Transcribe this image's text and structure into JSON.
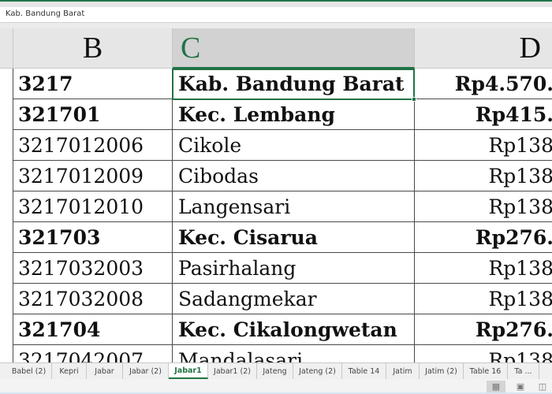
{
  "formula_bar": {
    "value": "Kab. Bandung Barat"
  },
  "column_headers": [
    {
      "label": "B",
      "selected": false
    },
    {
      "label": "C",
      "selected": true
    },
    {
      "label": "D",
      "selected": false
    }
  ],
  "selected_cell": {
    "column": "C",
    "value": "Kab. Bandung Barat"
  },
  "rows": [
    {
      "code": "3217",
      "name": "Kab.  Bandung  Barat",
      "amount": "Rp4.570.",
      "bold": true
    },
    {
      "code": "321701",
      "name": "Kec.  Lembang",
      "amount": "Rp415.",
      "bold": true
    },
    {
      "code": "3217012006",
      "name": "Cikole",
      "amount": "Rp138",
      "bold": false
    },
    {
      "code": "3217012009",
      "name": "Cibodas",
      "amount": "Rp138",
      "bold": false
    },
    {
      "code": "3217012010",
      "name": "Langensari",
      "amount": "Rp138",
      "bold": false
    },
    {
      "code": "321703",
      "name": "Kec.  Cisarua",
      "amount": "Rp276.",
      "bold": true
    },
    {
      "code": "3217032003",
      "name": "Pasirhalang",
      "amount": "Rp138",
      "bold": false
    },
    {
      "code": "3217032008",
      "name": "Sadangmekar",
      "amount": "Rp138",
      "bold": false
    },
    {
      "code": "321704",
      "name": "Kec.  Cikalongwetan",
      "amount": "Rp276.",
      "bold": true
    },
    {
      "code": "3217042007",
      "name": "Mandalasari",
      "amount": "Rp138",
      "bold": false
    }
  ],
  "sheet_tabs": [
    {
      "label": "Babel (2)",
      "active": false
    },
    {
      "label": "Kepri",
      "active": false
    },
    {
      "label": "Jabar",
      "active": false
    },
    {
      "label": "Jabar (2)",
      "active": false
    },
    {
      "label": "Jabar1",
      "active": true
    },
    {
      "label": "Jabar1 (2)",
      "active": false
    },
    {
      "label": "Jateng",
      "active": false
    },
    {
      "label": "Jateng (2)",
      "active": false
    },
    {
      "label": "Table 14",
      "active": false
    },
    {
      "label": "Jatim",
      "active": false
    },
    {
      "label": "Jatim (2)",
      "active": false
    },
    {
      "label": "Table 16",
      "active": false
    },
    {
      "label": "Ta ...",
      "active": false
    }
  ],
  "status_bar": {
    "views": [
      {
        "name": "normal-view",
        "icon": "▦",
        "active": true
      },
      {
        "name": "page-layout-view",
        "icon": "▣",
        "active": false
      },
      {
        "name": "page-break-view",
        "icon": "◫",
        "active": false
      }
    ]
  },
  "colors": {
    "accent": "#217346"
  }
}
